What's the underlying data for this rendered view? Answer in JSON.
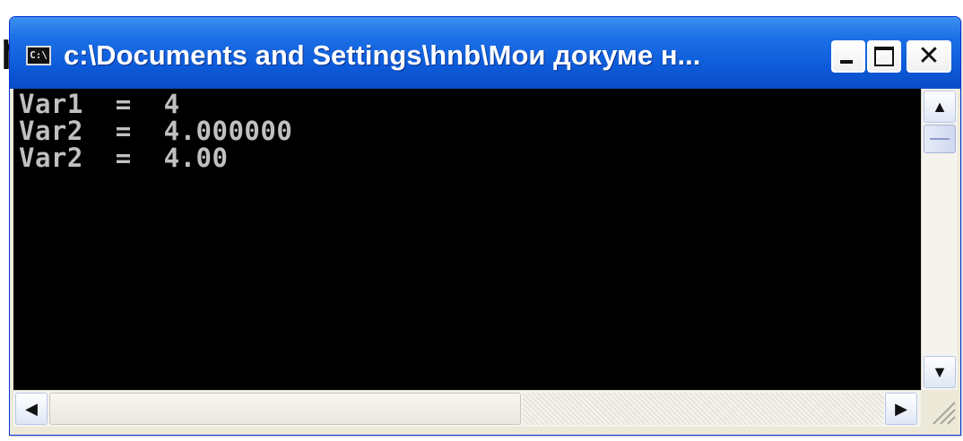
{
  "background_text": {
    "partial_letter": "n"
  },
  "window": {
    "title": "c:\\Documents and Settings\\hnb\\Мои докуме н...",
    "icon_label": "C:\\",
    "controls": {
      "minimize_icon": "minimize-icon",
      "maximize_icon": "maximize-icon",
      "close_icon": "close-icon",
      "close_glyph": "✕"
    }
  },
  "console": {
    "background_color": "#000000",
    "text_color": "#c0c0c0",
    "lines": [
      "Var1  =  4",
      "Var2  =  4.000000",
      "Var2  =  4.00"
    ]
  },
  "scrollbars": {
    "vertical": {
      "up_glyph": "▲",
      "down_glyph": "▼"
    },
    "horizontal": {
      "left_glyph": "◀",
      "right_glyph": "▶"
    }
  },
  "colors": {
    "titlebar": "#0d5ad8",
    "window_frame": "#ece9d8"
  }
}
